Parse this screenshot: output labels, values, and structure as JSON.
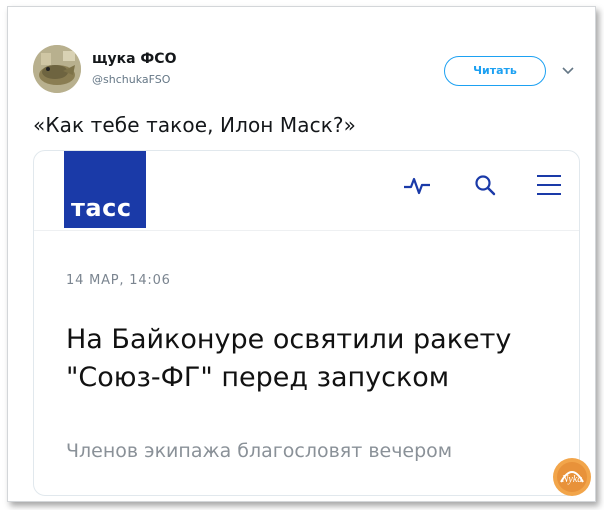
{
  "tweet": {
    "author_name": "щука ФСО",
    "author_handle": "@shchukaFSO",
    "follow_label": "Читать",
    "text": "«Как тебе такое, Илон Маск?»"
  },
  "card": {
    "logo_text": "тасс",
    "date": "14 МАР, 14:06",
    "title": "На Байконуре освятили ракету \"Союз-ФГ\" перед запуском",
    "subtitle": "Членов экипажа благословят вечером",
    "icons": [
      "pulse-icon",
      "search-icon",
      "menu-icon"
    ]
  },
  "watermark": {
    "text": "Nyka"
  },
  "colors": {
    "accent": "#1da1f2",
    "tass_blue": "#1a3aa8",
    "text": "#14171a",
    "muted": "#657786",
    "watermark": "#e8923a"
  }
}
